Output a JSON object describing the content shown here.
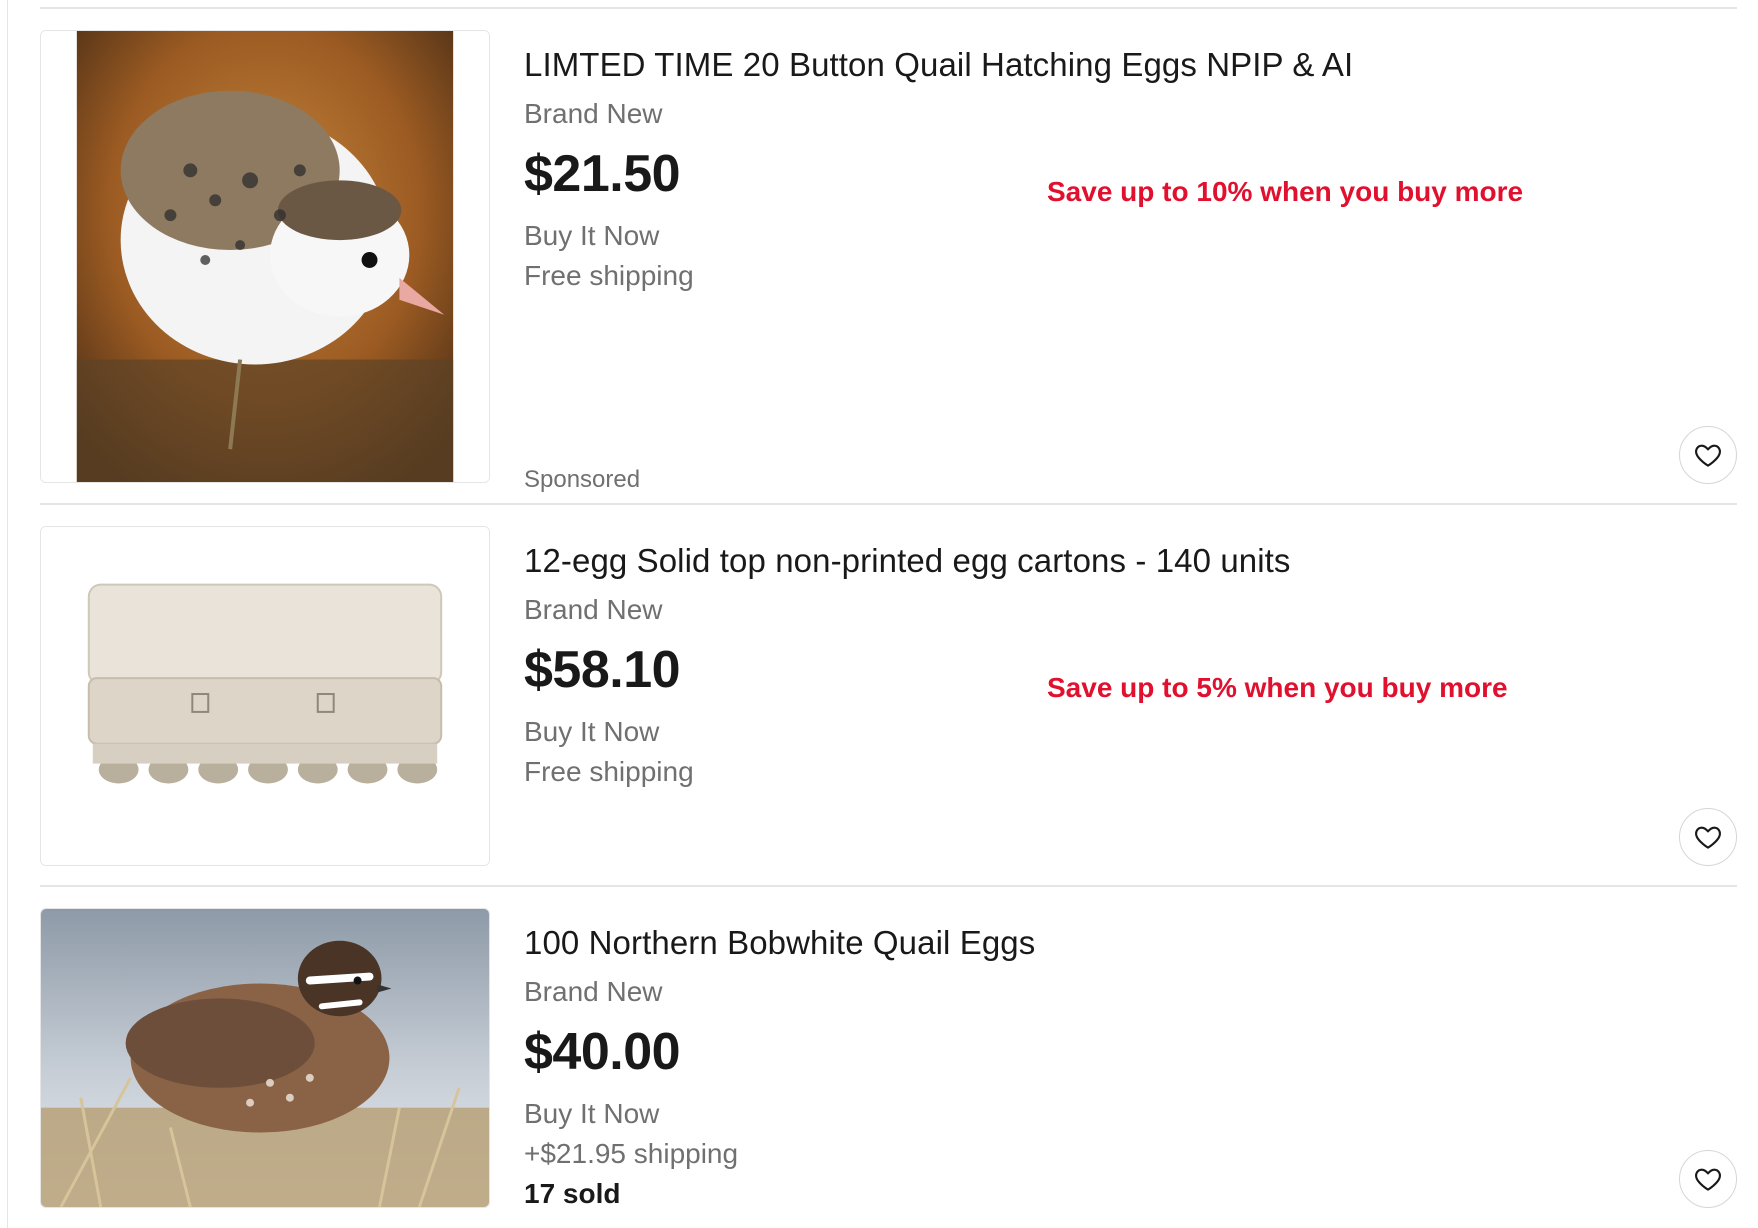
{
  "listings": [
    {
      "title": "LIMTED TIME 20 Button Quail Hatching Eggs NPIP & AI",
      "condition": "Brand New",
      "price": "$21.50",
      "format": "Buy It Now",
      "shipping": "Free shipping",
      "promo": "Save up to 10% when you buy more",
      "sponsored": "Sponsored",
      "image_icon": "quail-photo"
    },
    {
      "title": "12-egg Solid top non-printed egg cartons - 140 units",
      "condition": "Brand New",
      "price": "$58.10",
      "format": "Buy It Now",
      "shipping": "Free shipping",
      "promo": "Save up to 5% when you buy more",
      "image_icon": "egg-carton-photo"
    },
    {
      "title": "100 Northern Bobwhite Quail Eggs",
      "condition": "Brand New",
      "price": "$40.00",
      "format": "Buy It Now",
      "shipping": "+$21.95 shipping",
      "sold": "17 sold",
      "image_icon": "bobwhite-quail-photo"
    }
  ],
  "colors": {
    "promo": "#e0102e",
    "secondary_text": "#707070",
    "primary_text": "#191919",
    "divider": "#e5e5e5"
  },
  "icons": {
    "watch": "heart-icon"
  }
}
